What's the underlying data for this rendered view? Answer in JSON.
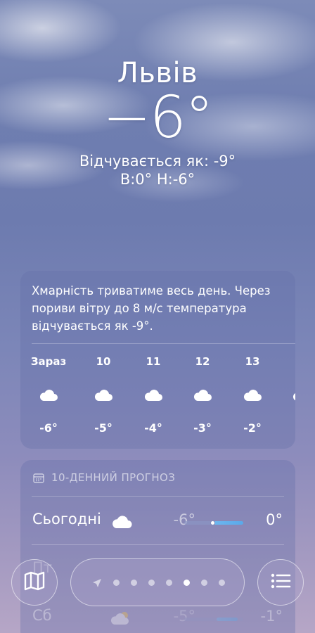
{
  "location": {
    "city": "Львів",
    "temperature": "−6°",
    "feels_like": "Відчувається як: -9°",
    "high_low": "В:0°  Н:-6°"
  },
  "hourly": {
    "summary": "Хмарність триватиме весь день. Через пориви вітру до 8 м/с температура відчувається як -9°.",
    "items": [
      {
        "time": "Зараз",
        "icon": "cloud-icon",
        "temp": "-6°"
      },
      {
        "time": "10",
        "icon": "cloud-icon",
        "temp": "-5°"
      },
      {
        "time": "11",
        "icon": "cloud-icon",
        "temp": "-4°"
      },
      {
        "time": "12",
        "icon": "cloud-icon",
        "temp": "-3°"
      },
      {
        "time": "13",
        "icon": "cloud-icon",
        "temp": "-2°"
      }
    ]
  },
  "daily": {
    "header": "10-ДЕННИЙ ПРОГНОЗ",
    "rows": [
      {
        "day": "Сьогодні",
        "icon": "cloud-icon",
        "low": "-6°",
        "high": "0°",
        "range_start": 0.46,
        "range_end": 1.0,
        "current": 0.48
      },
      {
        "day": "Сб",
        "icon": "sun-behind-cloud-icon",
        "low": "-5°",
        "high": "-1°",
        "range_start": 0.55,
        "range_end": 0.9
      }
    ]
  },
  "toolbar": {
    "page_count": 8,
    "active_page": 6,
    "map_icon": "map-icon",
    "list_icon": "list-icon",
    "location_icon": "location-arrow-icon"
  },
  "colors": {
    "accent_bar": "#5aa9ea"
  }
}
